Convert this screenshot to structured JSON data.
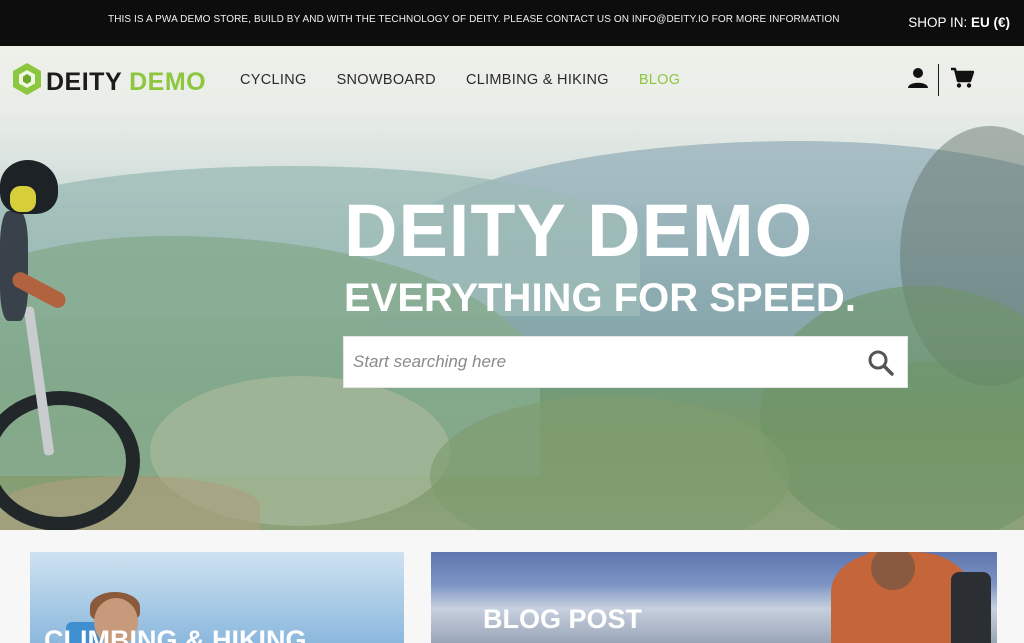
{
  "announcement": {
    "message": "THIS IS A PWA DEMO STORE, BUILD BY AND WITH THE TECHNOLOGY OF DEITY. PLEASE CONTACT US ON INFO@DEITY.IO FOR MORE INFORMATION",
    "shop_in_label": "SHOP IN:",
    "shop_in_value": "EU (€)"
  },
  "header": {
    "logo_word_1": "DEITY",
    "logo_word_2": "DEMO",
    "menu": [
      {
        "label": "CYCLING"
      },
      {
        "label": "SNOWBOARD"
      },
      {
        "label": "CLIMBING & HIKING"
      },
      {
        "label": "BLOG",
        "active": true
      }
    ],
    "icons": {
      "account": "user-icon",
      "cart": "cart-icon"
    }
  },
  "hero": {
    "title": "DEITY DEMO",
    "subtitle": "EVERYTHING FOR SPEED.",
    "search": {
      "placeholder": "Start searching here",
      "value": "",
      "icon": "search-icon"
    }
  },
  "cards": [
    {
      "title": "CLIMBING & HIKING"
    },
    {
      "title": "BLOG POST"
    }
  ],
  "colors": {
    "accent": "#8dc63f",
    "topbar_bg": "#0d0d0d",
    "text_dark": "#1c1c1c"
  }
}
